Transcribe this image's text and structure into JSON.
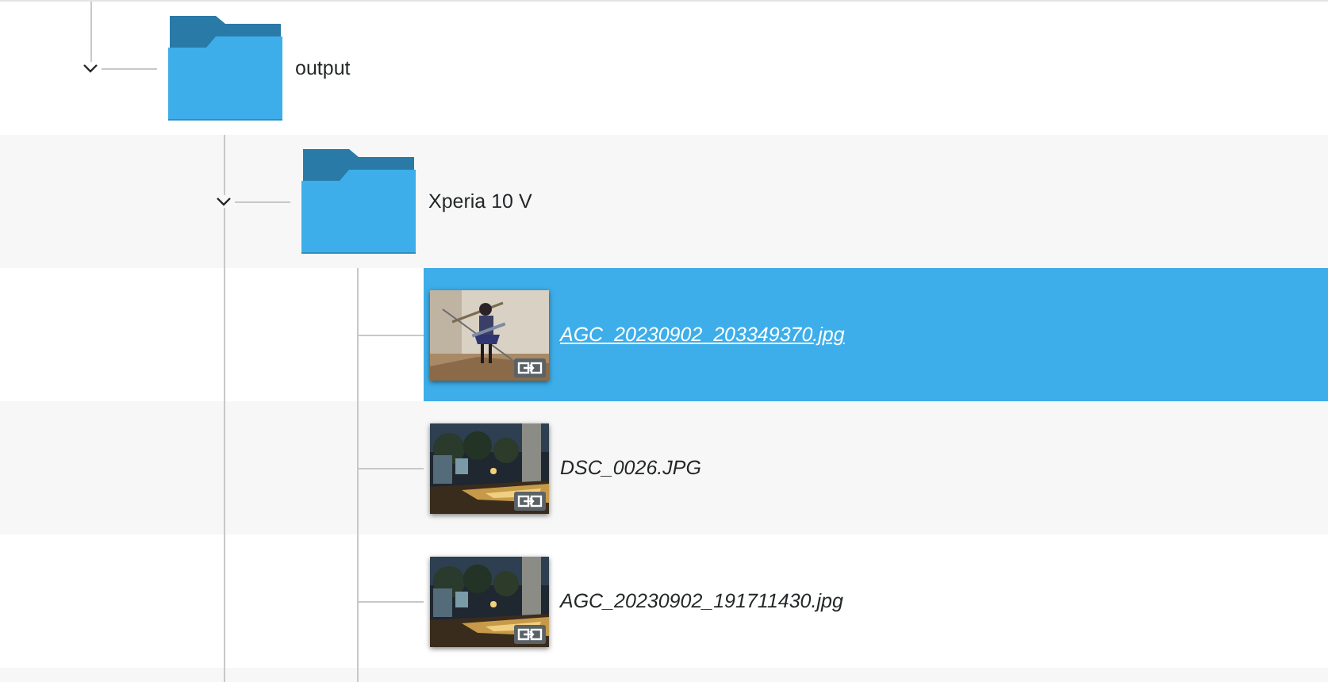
{
  "tree": [
    {
      "kind": "folder",
      "name": "output",
      "expanded": true,
      "children": [
        {
          "kind": "folder",
          "name": "Xperia 10 V",
          "expanded": true,
          "children": [
            {
              "kind": "file",
              "name": "AGC_20230902_203349370.jpg",
              "selected": true,
              "symlink": true
            },
            {
              "kind": "file",
              "name": "DSC_0026.JPG",
              "selected": false,
              "symlink": true
            },
            {
              "kind": "file",
              "name": "AGC_20230902_191711430.jpg",
              "selected": false,
              "symlink": true
            }
          ]
        }
      ]
    }
  ]
}
